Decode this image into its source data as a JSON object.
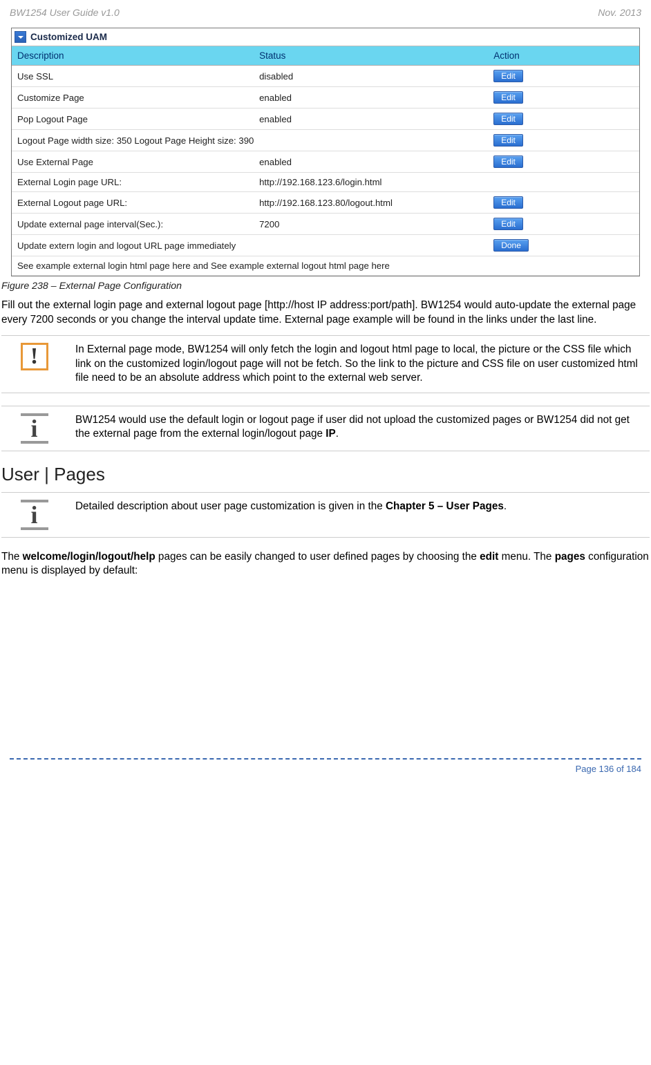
{
  "header": {
    "left": "BW1254 User Guide v1.0",
    "right": "Nov.  2013"
  },
  "panel": {
    "title": "Customized UAM",
    "columns": [
      "Description",
      "Status",
      "Action"
    ],
    "edit_label": "Edit",
    "done_label": "Done",
    "rows": [
      {
        "desc": "Use SSL",
        "status": "disabled",
        "action": "edit"
      },
      {
        "desc": "Customize Page",
        "status": "enabled",
        "action": "edit"
      },
      {
        "desc": "Pop Logout Page",
        "status": "enabled",
        "action": "edit"
      },
      {
        "desc": "Logout Page width size: 350  Logout Page Height size: 390",
        "status": "",
        "action": "edit",
        "colspan": 2
      },
      {
        "desc": "Use External Page",
        "status": "enabled",
        "action": "edit"
      },
      {
        "desc": "External Login page URL:",
        "status": "http://192.168.123.6/login.html",
        "action": ""
      },
      {
        "desc": "External Logout page URL:",
        "status": "http://192.168.123.80/logout.html",
        "action": "edit"
      },
      {
        "desc": "Update external page interval(Sec.):",
        "status": "7200",
        "action": "edit"
      },
      {
        "desc": "Update extern login and logout URL page immediately",
        "status": "",
        "action": "done",
        "colspan": 2
      },
      {
        "desc": "See example external login html page here and See example external logout html page here",
        "status": "",
        "action": "",
        "colspan": 3
      }
    ]
  },
  "caption": "Figure 238 – External Page Configuration",
  "para1": "Fill out the external login page and external logout page [http://host IP address:port/path]. BW1254 would auto-update the external page every 7200 seconds or you change the interval update time. External page example will be found in the links under the last line.",
  "warn": "In External page mode, BW1254 will only fetch the login and logout html page to local, the picture or the CSS file which link on the customized login/logout page will not be fetch. So the link to the picture and CSS file on user customized html file need to be an absolute address which point to the external web server.",
  "info1_a": "BW1254 would use the default login or logout page if user did not upload the customized pages or BW1254 did not get the external page from the external login/logout page ",
  "info1_b": "IP",
  "info1_c": ".",
  "section_title": "User | Pages",
  "info2_a": "Detailed description about user page customization is given in the ",
  "info2_b": "Chapter 5 – User Pages",
  "info2_c": ".",
  "para2_a": "The ",
  "para2_b": "welcome/login/logout/help",
  "para2_c": " pages can be easily changed to user defined pages by choosing the ",
  "para2_d": "edit",
  "para2_e": " menu. The ",
  "para2_f": "pages",
  "para2_g": " configuration menu is displayed by default:",
  "footer": "Page 136 of 184"
}
